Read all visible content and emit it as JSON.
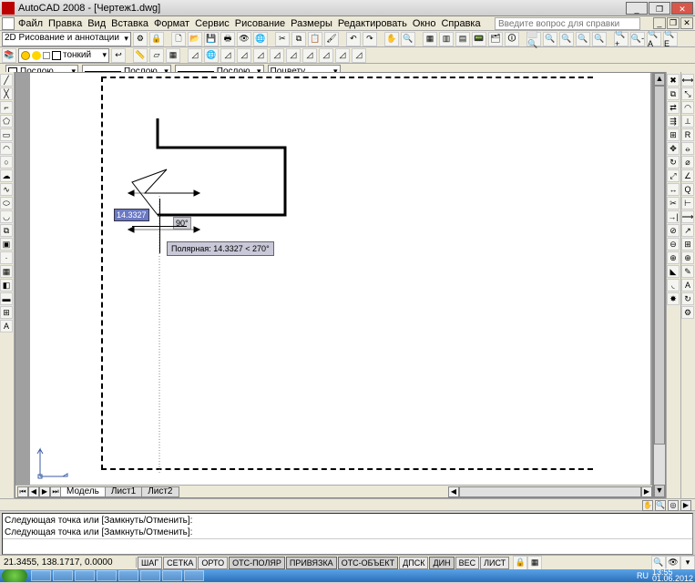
{
  "window": {
    "title": "AutoCAD 2008 - [Чертеж1.dwg]"
  },
  "menu": {
    "items": [
      "Файл",
      "Правка",
      "Вид",
      "Вставка",
      "Формат",
      "Сервис",
      "Рисование",
      "Размеры",
      "Редактировать",
      "Окно",
      "Справка"
    ],
    "help_placeholder": "Введите вопрос для справки"
  },
  "workspace": {
    "current": "2D Рисование и аннотации"
  },
  "layer": {
    "value": "тонкий"
  },
  "props": {
    "color": "Послою",
    "linetype": "Послою",
    "lineweight": "Послою",
    "plotstyle": "Поцвету"
  },
  "drawing": {
    "dyn_length": "14.3327",
    "dyn_angle": "90°",
    "tooltip": "Полярная: 14.3327 < 270°"
  },
  "tabs": {
    "model": "Модель",
    "sheets": [
      "Лист1",
      "Лист2"
    ]
  },
  "command": {
    "hist1": "Следующая точка или [Замкнуть/Отменить]:",
    "hist2": "Следующая точка или [Замкнуть/Отменить]:",
    "prompt": ""
  },
  "status": {
    "coords": "21.3455, 138.1717, 0.0000",
    "modes": [
      "ШАГ",
      "СЕТКА",
      "ОРТО",
      "ОТС-ПОЛЯР",
      "ПРИВЯЗКА",
      "ОТС-ОБЪЕКТ",
      "ДПСК",
      "ДИН",
      "ВЕС",
      "ЛИСТ"
    ],
    "modes_on": [
      false,
      false,
      false,
      true,
      true,
      true,
      false,
      true,
      false,
      false
    ],
    "lang": "RU",
    "time": "13:55",
    "date": "01.06.2012"
  },
  "draw_tools": [
    "line",
    "construction-line",
    "polyline",
    "polygon",
    "rectangle",
    "arc",
    "circle",
    "revision-cloud",
    "spline",
    "ellipse",
    "ellipse-arc",
    "insert-block",
    "make-block",
    "point",
    "hatch",
    "gradient",
    "region",
    "table",
    "text"
  ],
  "modify_tools": [
    "erase",
    "copy",
    "mirror",
    "offset",
    "array",
    "move",
    "rotate",
    "scale",
    "stretch",
    "trim",
    "extend",
    "break-at",
    "break",
    "join",
    "chamfer",
    "fillet",
    "explode"
  ],
  "dim_tools": [
    "linear",
    "aligned",
    "arc-length",
    "ordinate",
    "radius",
    "jogged",
    "diameter",
    "angular",
    "quick-dim",
    "baseline",
    "continue",
    "leader",
    "tolerance",
    "center",
    "dim-edit",
    "dim-text-edit",
    "dim-update"
  ],
  "chart_data": null
}
